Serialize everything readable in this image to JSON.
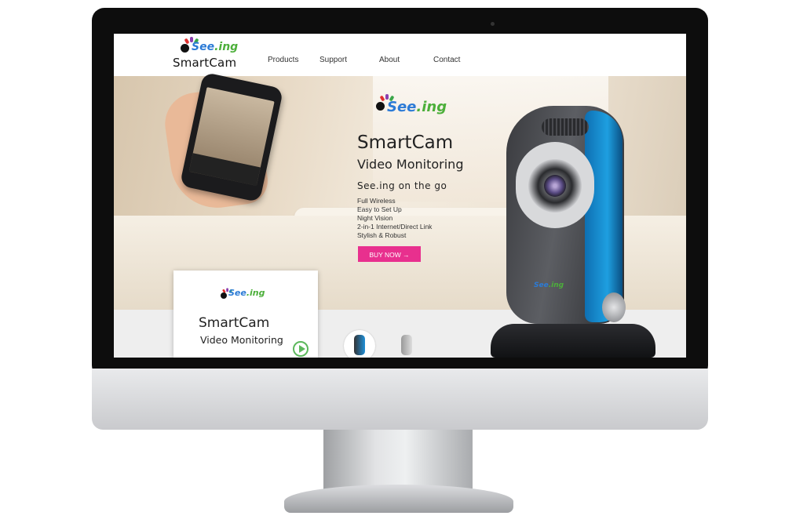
{
  "brand": {
    "see": "See",
    "ing": ".ing",
    "name": "SmartCam",
    "colors": {
      "see": "#2c7bd6",
      "ing": "#4caf3a",
      "accent": "#e8308e",
      "dot_red": "#e0302f",
      "dot_green": "#3aa64a",
      "dot_blue": "#2c7bd6",
      "dot_purple": "#8b3fb0"
    }
  },
  "nav": {
    "items": [
      {
        "label": "Products"
      },
      {
        "label": "Support"
      },
      {
        "label": "About"
      },
      {
        "label": "Contact"
      }
    ]
  },
  "hero": {
    "see": "See",
    "ing": ".ing",
    "title": "SmartCam",
    "subtitle": "Video Monitoring",
    "tagline": "See.ing on the go",
    "features": [
      "Full Wireless",
      "Easy to Set Up",
      "Night Vision",
      "2-in-1 Internet/Direct Link",
      "Stylish & Robust"
    ],
    "cta": "BUY NOW →",
    "camera_badge": {
      "see": "See",
      "ing": ".ing"
    }
  },
  "video_card": {
    "see": "See",
    "ing": ".ing",
    "title": "SmartCam",
    "subtitle": "Video Monitoring",
    "play_icon": "play-icon"
  },
  "thumbnails": [
    {
      "icon": "camera-thumbnail-icon"
    },
    {
      "icon": "camera-thumbnail-icon"
    }
  ]
}
